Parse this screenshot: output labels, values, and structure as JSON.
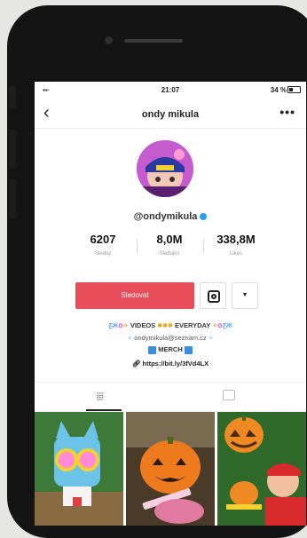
{
  "status": {
    "time": "21:07",
    "battery": "34 %"
  },
  "header": {
    "title": "ondy mikula",
    "back_icon": "chevron-left-icon",
    "more_label": "•••"
  },
  "profile": {
    "handle": "@ondymikula"
  },
  "stats": [
    {
      "value": "6207",
      "label": "Sleduji"
    },
    {
      "value": "8,0M",
      "label": "Sledující"
    },
    {
      "value": "338,8M",
      "label": "Likes"
    }
  ],
  "actions": {
    "follow_label": "Sledovat",
    "dropdown_glyph": "▼"
  },
  "bio": {
    "line1": "VIDEOS",
    "line1b": "EVERYDAY",
    "line2": "ondymikula@seznam.cz",
    "line3": "MERCH",
    "link": "https://bit.ly/3fVd4LX"
  },
  "tabs": {
    "grid_glyph": "⦙⦙⦙"
  },
  "colors": {
    "accent": "#ea4d5a",
    "verified": "#25a0e8"
  }
}
